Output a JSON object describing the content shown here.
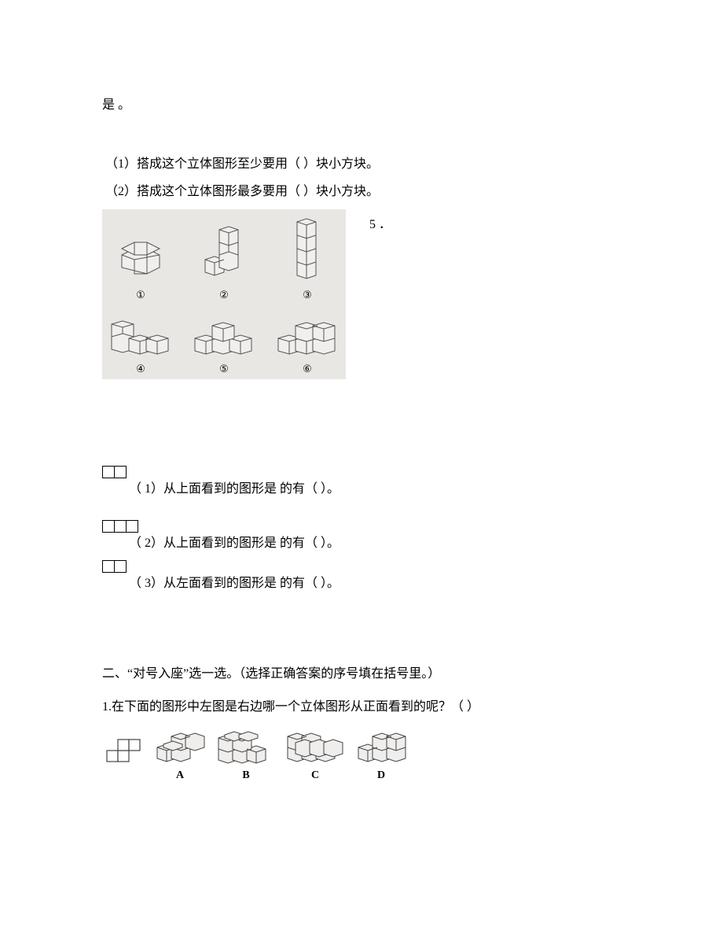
{
  "top_lead": "是 。",
  "sub_q1": "（1）搭成这个立体图形至少要用（  ）块小方块。",
  "sub_q2": "（2）搭成这个立体图形最多要用（  ）块小方块。",
  "q5_marker": "5 ．",
  "solid_labels": {
    "a": "①",
    "b": "②",
    "c": "③",
    "d": "④",
    "e": "⑤",
    "f": "⑥"
  },
  "view_q1": "（ 1）从上面看到的图形是  的有（  ）。",
  "view_q2": "（ 2）从上面看到的图形是  的有（  ）。",
  "view_q3": "（ 3）从左面看到的图形是  的有（  ）。",
  "section2_title": "二、“对号入座”选一选。（选择正确答案的序号填在括号里。）",
  "mc_q1": "1.在下面的图形中左图是右边哪一个立体图形从正面看到的呢？（  ）",
  "mc_labels": {
    "a": "A",
    "b": "B",
    "c": "C",
    "d": "D"
  }
}
